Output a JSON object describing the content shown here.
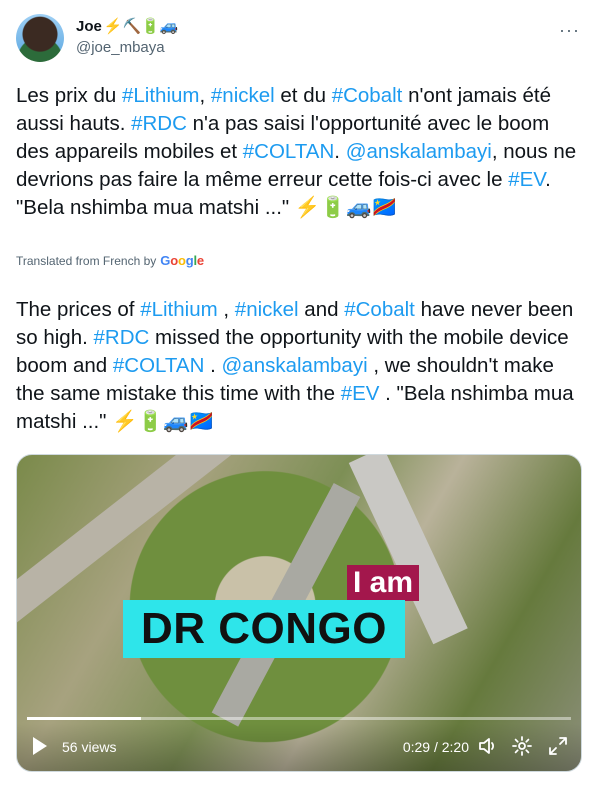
{
  "author": {
    "name": "Joe",
    "name_emojis": "⚡⛏️🔋🚙",
    "handle": "@joe_mbaya"
  },
  "menu_glyph": "···",
  "tweet": {
    "original": [
      {
        "text": "Les prix du ",
        "tag": false
      },
      {
        "text": "#Lithium",
        "tag": true
      },
      {
        "text": ", ",
        "tag": false
      },
      {
        "text": "#nickel",
        "tag": true
      },
      {
        "text": " et du ",
        "tag": false
      },
      {
        "text": "#Cobalt",
        "tag": true
      },
      {
        "text": " n'ont jamais été aussi hauts. ",
        "tag": false
      },
      {
        "text": "#RDC",
        "tag": true
      },
      {
        "text": " n'a pas saisi l'opportunité avec le boom des appareils mobiles et ",
        "tag": false
      },
      {
        "text": "#COLTAN",
        "tag": true
      },
      {
        "text": ". ",
        "tag": false
      },
      {
        "text": "@anskalambayi",
        "tag": true
      },
      {
        "text": ", nous ne devrions pas faire la même erreur cette fois-ci avec le ",
        "tag": false
      },
      {
        "text": "#EV",
        "tag": true
      },
      {
        "text": ". \"Bela nshimba mua matshi ...\" ⚡🔋🚙🇨🇩",
        "tag": false
      }
    ],
    "translated_label": "Translated from French by",
    "translator_brand": "Google",
    "translation": [
      {
        "text": "The prices of ",
        "tag": false
      },
      {
        "text": "#Lithium",
        "tag": true
      },
      {
        "text": " , ",
        "tag": false
      },
      {
        "text": "#nickel",
        "tag": true
      },
      {
        "text": " and ",
        "tag": false
      },
      {
        "text": "#Cobalt",
        "tag": true
      },
      {
        "text": " have never been so high. ",
        "tag": false
      },
      {
        "text": "#RDC",
        "tag": true
      },
      {
        "text": " missed the opportunity with the mobile device boom and ",
        "tag": false
      },
      {
        "text": "#COLTAN",
        "tag": true
      },
      {
        "text": " . ",
        "tag": false
      },
      {
        "text": "@anskalambayi",
        "tag": true
      },
      {
        "text": " , we shouldn't make the same mistake this time with the ",
        "tag": false
      },
      {
        "text": "#EV",
        "tag": true
      },
      {
        "text": " . \"Bela nshimba mua matshi ...\" ⚡🔋🚙🇨🇩",
        "tag": false
      }
    ]
  },
  "video": {
    "overlay_line1": "I am",
    "overlay_line2": "DR CONGO",
    "views": "56 views",
    "time": "0:29 / 2:20",
    "progress": 0.21,
    "icons": [
      "play-icon",
      "volume-icon",
      "settings-icon",
      "fullscreen-icon"
    ]
  }
}
